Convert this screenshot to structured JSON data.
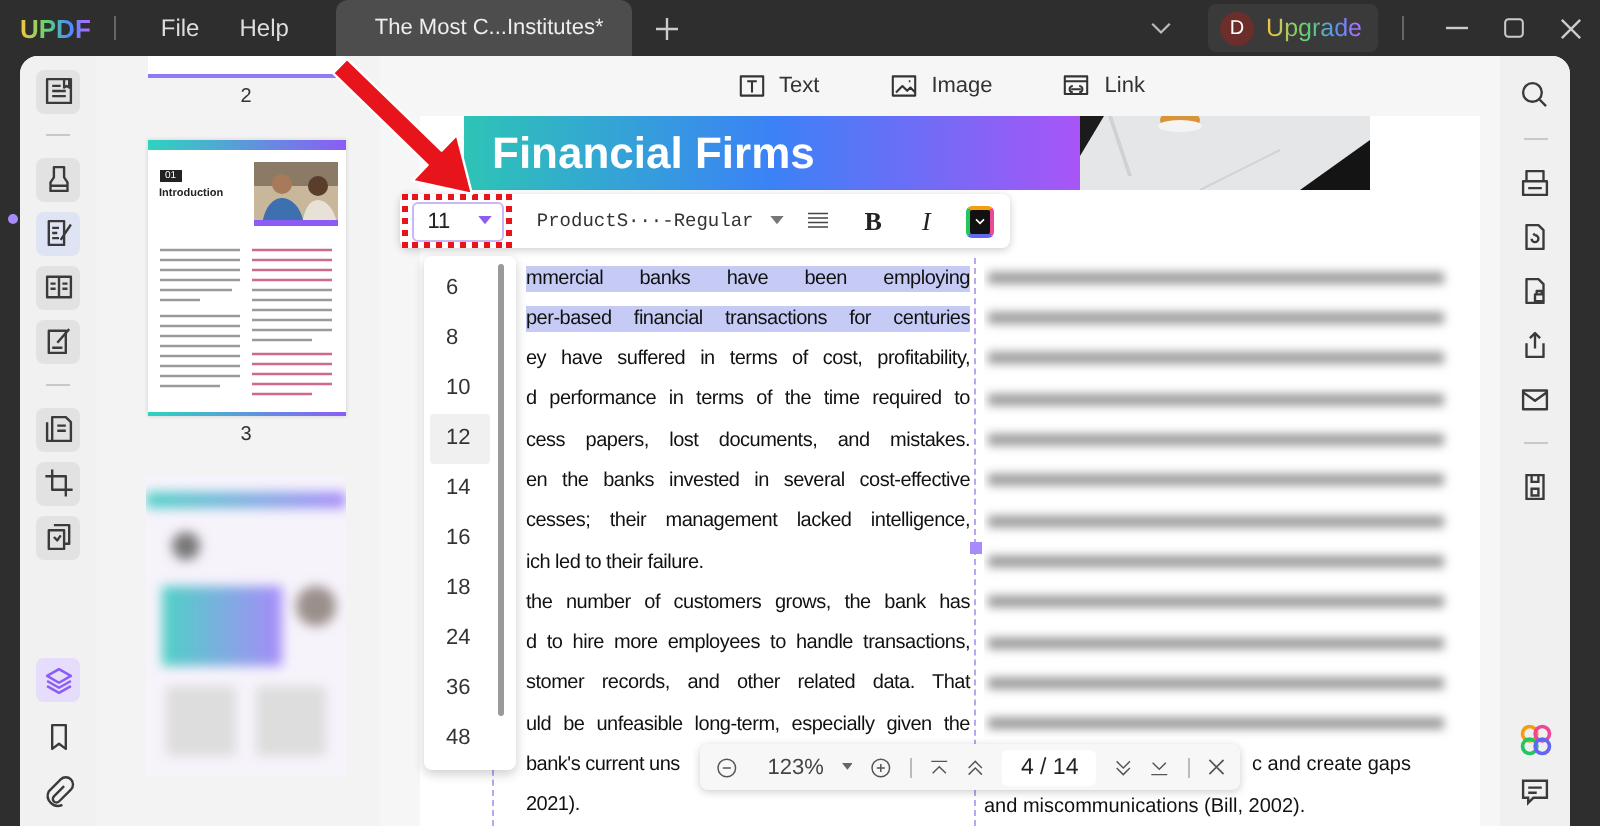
{
  "menu_bar": {
    "logo": "UPDF",
    "items": [
      "File",
      "Help"
    ]
  },
  "tabs": [
    {
      "label": "The Most C...Institutes*",
      "selected": true
    }
  ],
  "account": {
    "avatar": "D",
    "button": "Upgrade"
  },
  "left_tool_groups": [
    [
      {
        "selected": false
      }
    ],
    [
      {
        "selected": false
      },
      {
        "selected": true
      },
      {
        "selected": false
      },
      {
        "selected": false
      }
    ],
    [
      {
        "selected": false
      },
      {
        "selected": false
      },
      {
        "selected": false
      }
    ]
  ],
  "left_bottom_tools": [
    {
      "selected": true
    },
    {
      "selected": false
    },
    {
      "selected": false
    }
  ],
  "thumbnails": {
    "page_2_label": "2",
    "page_3": {
      "label": "3",
      "section_number": "01",
      "heading": "Introduction"
    }
  },
  "edit_tools": [
    {
      "label": "Text"
    },
    {
      "label": "Image"
    },
    {
      "label": "Link"
    }
  ],
  "document": {
    "banner_title": "Financial Firms",
    "column_1": [
      {
        "text": "mmercial banks have been employing",
        "selected": true,
        "justified": true
      },
      {
        "text": "per-based financial transactions for centuries",
        "selected": true,
        "justified": true
      },
      {
        "text": "ey have suffered in terms of cost, profitability,",
        "selected": false,
        "justified": true
      },
      {
        "text": "d performance in terms of the time required to",
        "selected": false,
        "justified": true
      },
      {
        "text": "cess papers, lost documents, and mistakes.",
        "selected": false,
        "justified": true
      },
      {
        "text": "en the banks invested in several cost-effective",
        "selected": false,
        "justified": true
      },
      {
        "text": "cesses; their management lacked intelligence,",
        "selected": false,
        "justified": true
      },
      {
        "text": "ich led to their failure.",
        "selected": false,
        "justified": false
      },
      {
        "text": "the number of customers grows, the bank has",
        "selected": false,
        "justified": true
      },
      {
        "text": "d to hire more employees to handle transactions,",
        "selected": false,
        "justified": true
      },
      {
        "text": "stomer records, and other related data. That",
        "selected": false,
        "justified": true
      },
      {
        "text": "uld be unfeasible long-term, especially given the",
        "selected": false,
        "justified": true
      },
      {
        "text": "bank's current uns",
        "selected": false,
        "justified": false
      },
      {
        "text": "2021).",
        "selected": false,
        "justified": false
      }
    ],
    "column_2": [
      "c and create gaps",
      "and miscommunications (Bill, 2002)."
    ]
  },
  "format_bar": {
    "font_size": "11",
    "font": "ProductS···-Regular",
    "bold": "B",
    "italic": "I"
  },
  "font_size_options": [
    {
      "label": "6",
      "selected": false
    },
    {
      "label": "8",
      "selected": false
    },
    {
      "label": "10",
      "selected": false
    },
    {
      "label": "12",
      "selected": true
    },
    {
      "label": "14",
      "selected": false
    },
    {
      "label": "16",
      "selected": false
    },
    {
      "label": "18",
      "selected": false
    },
    {
      "label": "24",
      "selected": false
    },
    {
      "label": "36",
      "selected": false
    },
    {
      "label": "48",
      "selected": false
    }
  ],
  "zoom_bar": {
    "zoom": "123%",
    "page": "4 / 14"
  }
}
